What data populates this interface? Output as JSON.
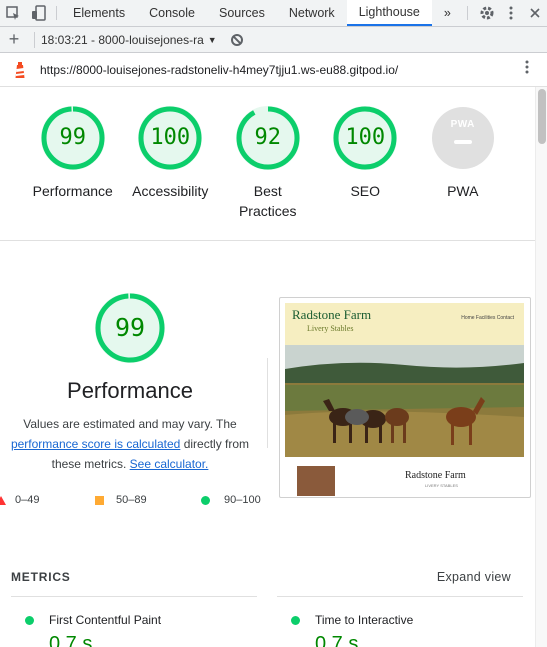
{
  "devtools": {
    "tabs": [
      {
        "label": "Elements"
      },
      {
        "label": "Console"
      },
      {
        "label": "Sources"
      },
      {
        "label": "Network"
      },
      {
        "label": "Lighthouse"
      }
    ],
    "more_tabs": "»",
    "active_tab": "Lighthouse"
  },
  "lighthouse_bar": {
    "add_label": "+",
    "report_select": "18:03:21 - 8000-louisejones-ra",
    "dropdown_arrow": "▼"
  },
  "url_row": {
    "url": "https://8000-louisejones-radstoneliv-h4mey7tjju1.ws-eu88.gitpod.io/"
  },
  "category_gauges": [
    {
      "score": "99",
      "label": "Performance",
      "fraction": 0.99
    },
    {
      "score": "100",
      "label": "Accessibility",
      "fraction": 1.0
    },
    {
      "score": "92",
      "label": "Best Practices",
      "fraction": 0.92
    },
    {
      "score": "100",
      "label": "SEO",
      "fraction": 1.0
    },
    {
      "label": "PWA",
      "badge_text": "PWA"
    }
  ],
  "performance": {
    "score": "99",
    "fraction": 0.99,
    "title": "Performance",
    "desc_prefix": "Values are estimated and may vary. The",
    "desc_link": "performance score is calculated",
    "desc_middle": "directly from these metrics.",
    "calc_link": "See calculator.",
    "legend": [
      {
        "range": "0–49",
        "color": "#ff3333"
      },
      {
        "range": "50–89",
        "color": "#ffaa33"
      },
      {
        "range": "90–100",
        "color": "#0cce6b"
      }
    ]
  },
  "screenshot": {
    "site_title": "Radstone Farm",
    "site_subtitle": "Livery Stables",
    "nav": "Home  Facilities  Contact",
    "footer_title": "Radstone Farm",
    "footer_sub": "LIVERY STABLES"
  },
  "metrics": {
    "title": "METRICS",
    "expand": "Expand view",
    "items": [
      {
        "label": "First Contentful Paint",
        "value": "0.7 s"
      },
      {
        "label": "Time to Interactive",
        "value": "0.7 s"
      }
    ]
  },
  "colors": {
    "pass": "#0cce6b",
    "pass_text": "#008800",
    "average": "#ffaa33",
    "fail": "#ff3333",
    "accent": "#1a73e8"
  }
}
